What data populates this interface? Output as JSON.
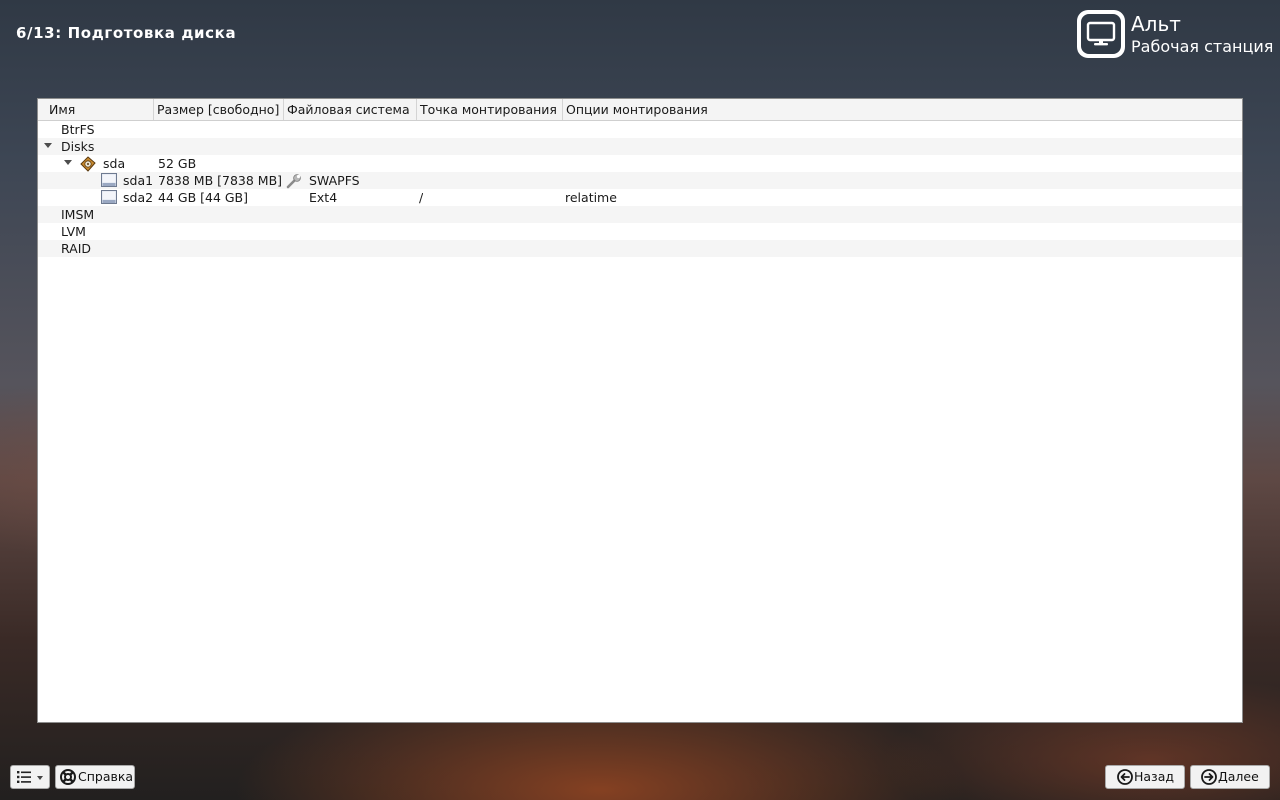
{
  "header": {
    "step_title": "6/13: Подготовка диска"
  },
  "brand": {
    "name": "Альт",
    "subtitle": "Рабочая станция",
    "icon": "monitor-icon"
  },
  "tree": {
    "columns": [
      "Имя",
      "Размер [свободно]",
      "Файловая система",
      "Точка монтирования",
      "Опции монтирования"
    ],
    "rows": {
      "btrfs": {
        "name": "BtrFS"
      },
      "disks": {
        "name": "Disks"
      },
      "sda": {
        "name": "sda",
        "size": "52 GB",
        "icon": "hard-disk-icon"
      },
      "sda1": {
        "name": "sda1",
        "size": "7838 MB [7838 MB]",
        "fs": "SWAPFS",
        "fs_icon": "wrench-icon",
        "icon": "partition-icon"
      },
      "sda2": {
        "name": "sda2",
        "size": "44 GB [44 GB]",
        "fs": "Ext4",
        "mount": "/",
        "options": "relatime",
        "icon": "partition-icon"
      },
      "imsm": {
        "name": "IMSM"
      },
      "lvm": {
        "name": "LVM"
      },
      "raid": {
        "name": "RAID"
      }
    }
  },
  "footer": {
    "menu_icon": "list-icon",
    "help_label": "Справка",
    "help_icon": "lifebuoy-icon",
    "back_label": "Назад",
    "back_icon": "arrow-left-circle-icon",
    "next_label": "Далее",
    "next_icon": "arrow-right-circle-icon"
  }
}
